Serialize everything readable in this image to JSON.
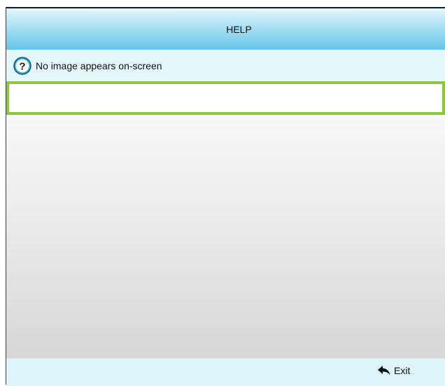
{
  "header": {
    "title": "HELP"
  },
  "help_topic": {
    "icon": "question-mark-icon",
    "text": "No image appears on-screen"
  },
  "footer": {
    "exit_label": "Exit",
    "exit_icon": "return-arrow-icon"
  },
  "colors": {
    "header_gradient_top": "#e4f7fc",
    "header_gradient_bottom": "#63c6ea",
    "selection_border": "#8dc63f",
    "help_icon_fill": "#2aa6d9",
    "footer_background": "#dff5fc"
  }
}
